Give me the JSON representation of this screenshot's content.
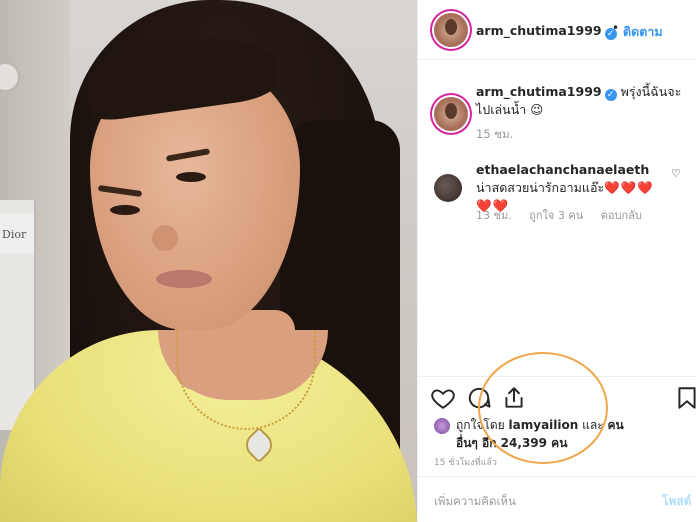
{
  "post": {
    "username": "arm_chutima1999",
    "verified_badge": "✓",
    "dot": "•",
    "follow_label": "ติดตาม",
    "caption": {
      "username": "arm_chutima1999",
      "text": "พรุ่งนี้ฉันจะไปเล่นน้ำ 😉",
      "time": "15 ชม."
    },
    "comment": {
      "username": "ethaelachanchanaelaeth",
      "text": "น่าสดสวยน่ารักอามแอ๊ะ",
      "hearts": "❤️❤️❤️❤️❤️",
      "time": "13 ชม.",
      "likes": "ถูกใจ 3 คน",
      "reply": "ตอบกลับ",
      "like_icon": "♡"
    },
    "likes": {
      "prefix": "ถูกใจโดย",
      "user": "lamyailion",
      "and": "และ",
      "others": "คนอื่นๆ อีก 24,399 คน"
    },
    "post_time": "15 ชั่วโมงที่แล้ว",
    "add_comment_placeholder": "เพิ่มความคิดเห็น",
    "post_button": "โพสต์",
    "icons": [
      "heart-icon",
      "comment-icon",
      "share-icon",
      "bookmark-icon"
    ]
  },
  "colors": {
    "accent": "#3897f0",
    "highlight": "#f0a64a",
    "heart": "#e0245e"
  },
  "photo_text": "Dior"
}
